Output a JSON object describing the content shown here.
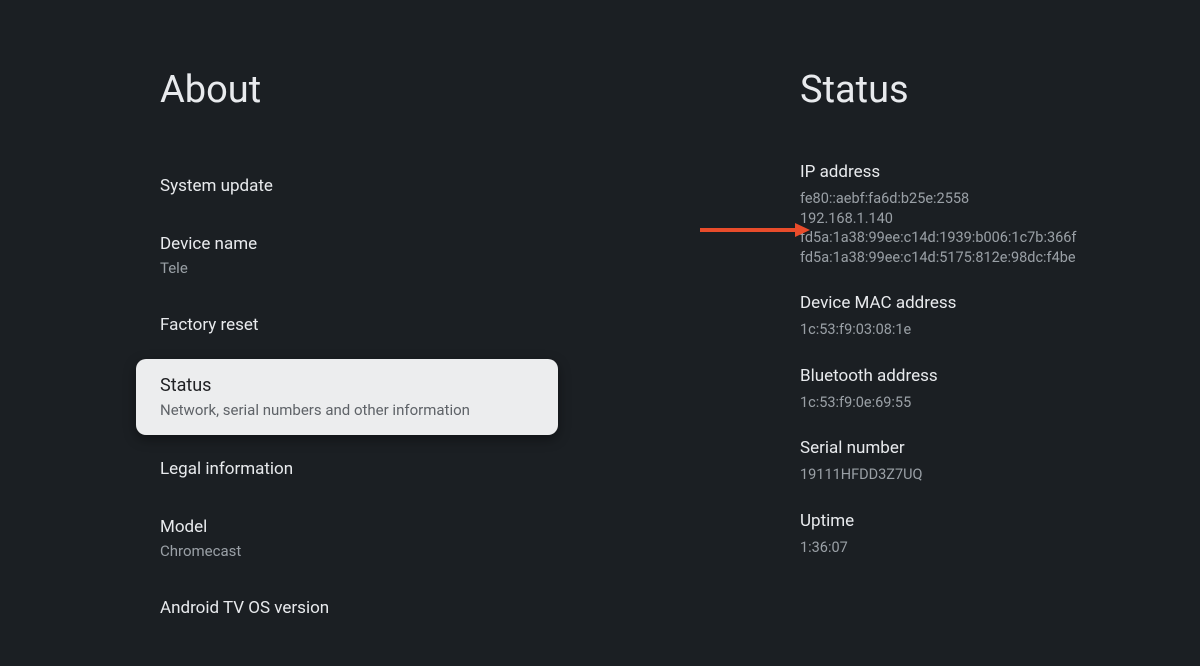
{
  "left": {
    "title": "About",
    "items": [
      {
        "title": "System update"
      },
      {
        "title": "Device name",
        "subtitle": "Tele"
      },
      {
        "title": "Factory reset"
      },
      {
        "title": "Status",
        "subtitle": "Network, serial numbers and other information",
        "selected": true
      },
      {
        "title": "Legal information"
      },
      {
        "title": "Model",
        "subtitle": "Chromecast"
      },
      {
        "title": "Android TV OS version"
      }
    ]
  },
  "right": {
    "title": "Status",
    "sections": [
      {
        "label": "IP address",
        "lines": [
          "fe80::aebf:fa6d:b25e:2558",
          "192.168.1.140",
          "fd5a:1a38:99ee:c14d:1939:b006:1c7b:366f",
          "fd5a:1a38:99ee:c14d:5175:812e:98dc:f4be"
        ]
      },
      {
        "label": "Device MAC address",
        "lines": [
          "1c:53:f9:03:08:1e"
        ]
      },
      {
        "label": "Bluetooth address",
        "lines": [
          "1c:53:f9:0e:69:55"
        ]
      },
      {
        "label": "Serial number",
        "lines": [
          "19111HFDD3Z7UQ"
        ]
      },
      {
        "label": "Uptime",
        "lines": [
          "1:36:07"
        ]
      }
    ]
  },
  "annotation": {
    "arrow_color": "#e94c2b"
  }
}
